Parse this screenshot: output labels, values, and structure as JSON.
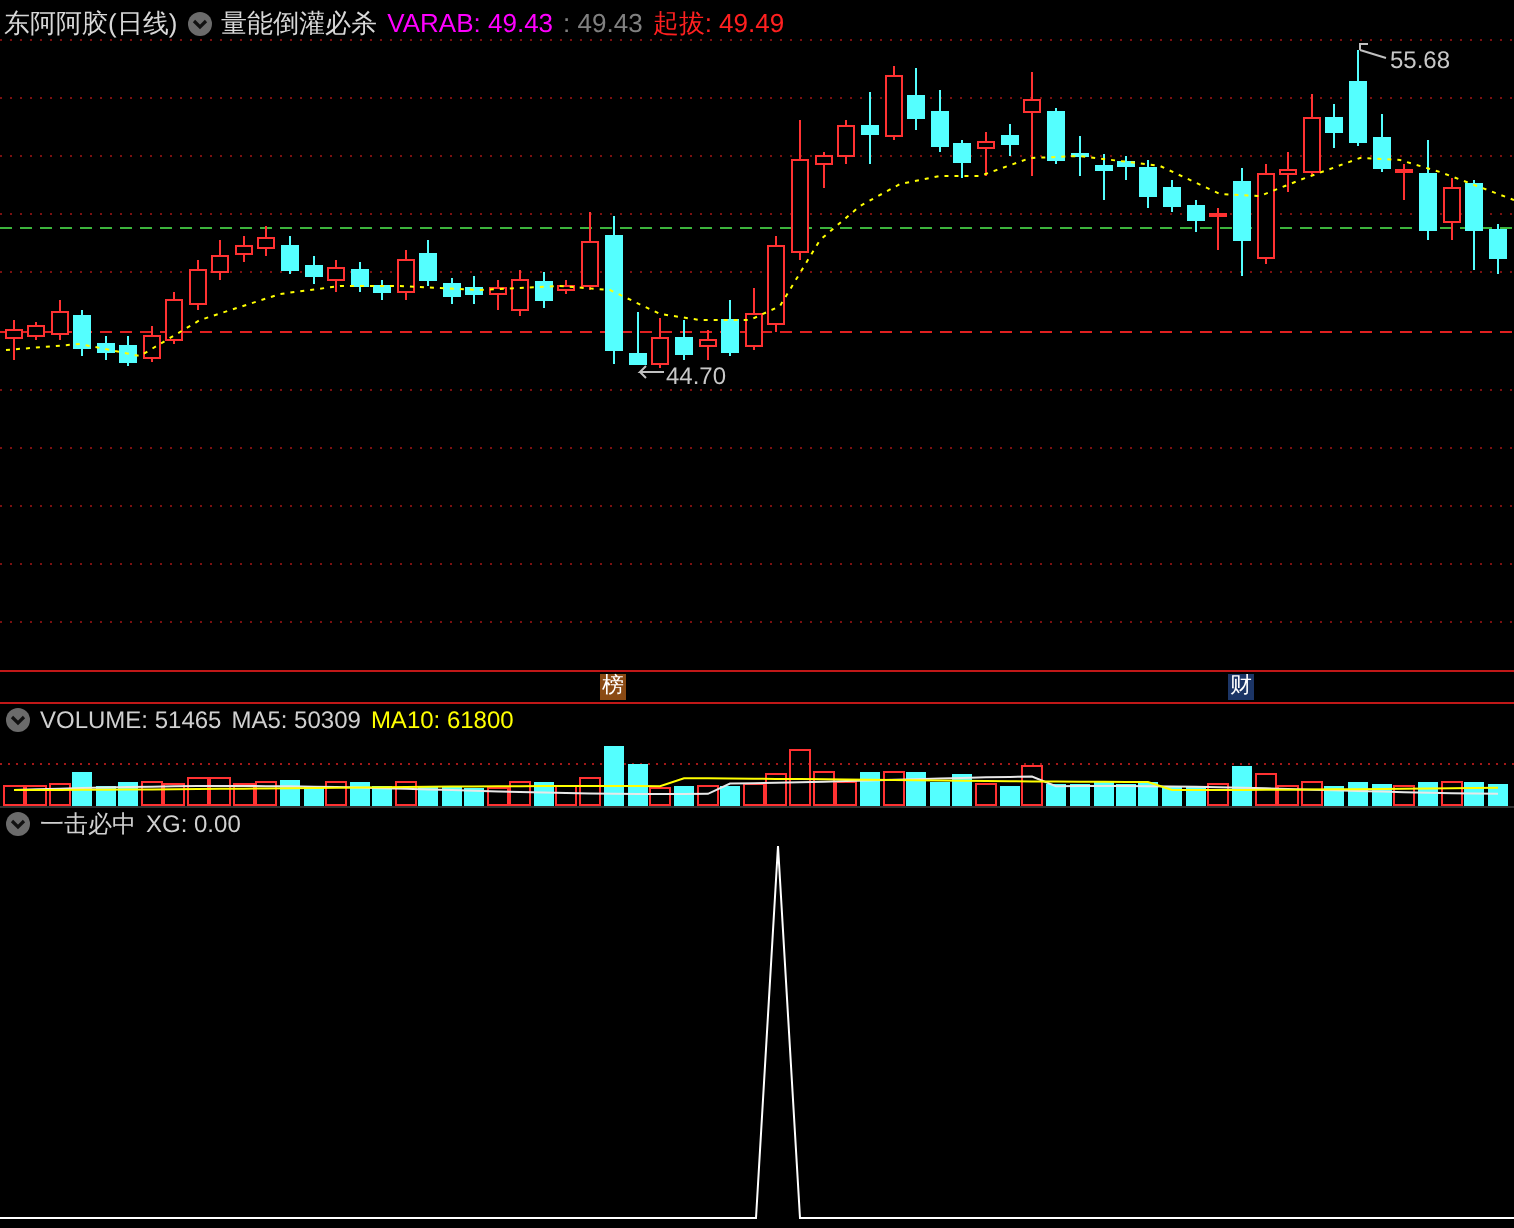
{
  "stock_header": {
    "title": "东阿阿胶(日线)",
    "indicator": "量能倒灌必杀",
    "values": [
      {
        "text": "VARAB: 49.43",
        "color": "#ff00ff"
      },
      {
        "text": ": 49.43",
        "color": "#808080"
      },
      {
        "text": "起拔: 49.49",
        "color": "#ff2020"
      }
    ]
  },
  "price_labels": [
    {
      "text": "55.68",
      "kind": "high"
    },
    {
      "text": "44.70",
      "kind": "low"
    }
  ],
  "event_markers": [
    {
      "text": "榜",
      "color": "#8a4a14"
    },
    {
      "text": "财",
      "color": "#1c3566"
    }
  ],
  "volume_header": {
    "values": [
      {
        "text": "VOLUME: 51465",
        "color": "#d0d0d0"
      },
      {
        "text": "MA5: 50309",
        "color": "#d0d0d0"
      },
      {
        "text": "MA10: 61800",
        "color": "#ffff00"
      }
    ]
  },
  "signal_header": {
    "name": "一击必中",
    "values": [
      {
        "text": "XG: 0.00",
        "color": "#d0d0d0"
      }
    ]
  }
}
